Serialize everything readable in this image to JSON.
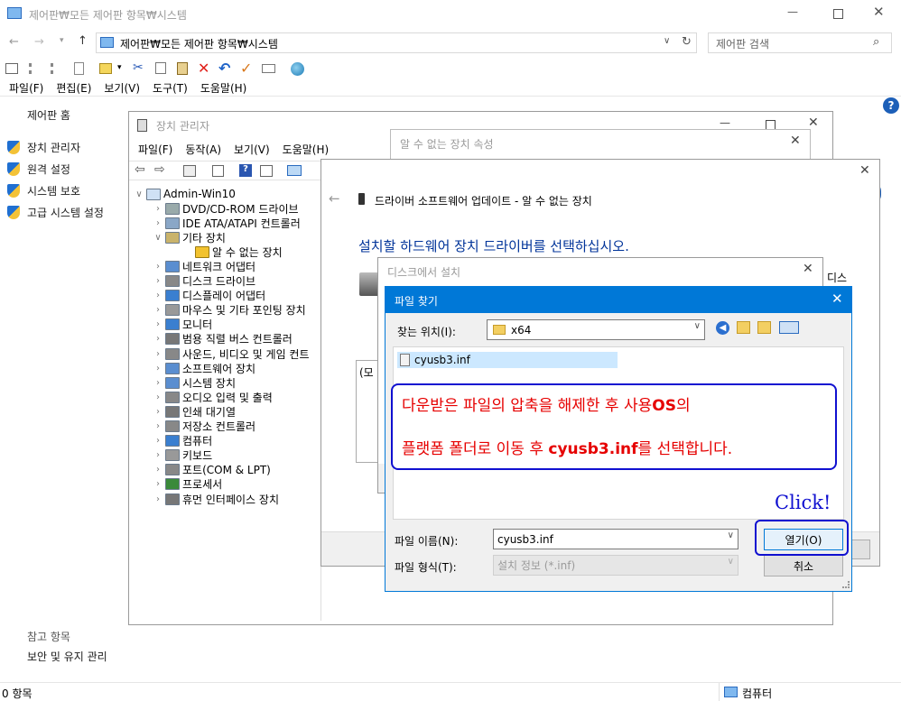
{
  "explorer": {
    "title": "제어판₩모든 제어판 항목₩시스템",
    "address": "제어판₩모든 제어판 항목₩시스템",
    "search_placeholder": "제어판 검색",
    "menu": [
      "파일(F)",
      "편집(E)",
      "보기(V)",
      "도구(T)",
      "도움말(H)"
    ],
    "sidebar": {
      "home": "제어판 홈",
      "items": [
        "장치 관리자",
        "원격 설정",
        "시스템 보호",
        "고급 시스템 설정"
      ],
      "see_also": "참고 항목",
      "security": "보안 및 유지 관리"
    },
    "status_left": "0 항목",
    "status_right": "컴퓨터"
  },
  "device_manager": {
    "title": "장치 관리자",
    "menu": [
      "파일(F)",
      "동작(A)",
      "보기(V)",
      "도움말(H)"
    ],
    "root": "Admin-Win10",
    "nodes": [
      "DVD/CD-ROM 드라이브",
      "IDE ATA/ATAPI 컨트롤러",
      "기타 장치",
      "알 수 없는 장치",
      "네트워크 어댑터",
      "디스크 드라이브",
      "디스플레이 어댑터",
      "마우스 및 기타 포인팅 장치",
      "모니터",
      "범용 직렬 버스 컨트롤러",
      "사운드, 비디오 및 게임 컨트",
      "소프트웨어 장치",
      "시스템 장치",
      "오디오 입력 및 출력",
      "인쇄 대기열",
      "저장소 컨트롤러",
      "컴퓨터",
      "키보드",
      "포트(COM & LPT)",
      "프로세서",
      "휴먼 인터페이스 장치"
    ]
  },
  "unknown_props": {
    "title": "알 수 없는 장치 속성"
  },
  "driver_update": {
    "header": "드라이버 소프트웨어 업데이트 - 알 수 없는 장치",
    "instruction": "설치할 하드웨어 장치 드라이버를 선택하십시오.",
    "partial_right": "디스",
    "partial_box": "(모"
  },
  "install_disk": {
    "title": "디스크에서 설치"
  },
  "file_dialog": {
    "title": "파일 찾기",
    "look_in_label": "찾는 위치(I):",
    "look_in_value": "x64",
    "file_item": "cyusb3.inf",
    "filename_label": "파일 이름(N):",
    "filename_value": "cyusb3.inf",
    "filetype_label": "파일 형식(T):",
    "filetype_value": "설치 정보 (*.inf)",
    "open_button": "열기(O)",
    "cancel_button": "취소"
  },
  "annotation": {
    "line1_pre": "다운받은 파일의 압축을 해제한 후 사용",
    "line1_bold": "OS",
    "line1_post": "의",
    "line2_pre": "플랫폼 폴더로 이동 후 ",
    "line2_bold": "cyusb3.inf",
    "line2_post": "를 선택합니다.",
    "click": "Click!"
  },
  "colors": {
    "annotation_red": "#e60000",
    "annotation_blue": "#1010d0",
    "dialog_blue": "#0078d7",
    "instruction_blue": "#003399"
  }
}
